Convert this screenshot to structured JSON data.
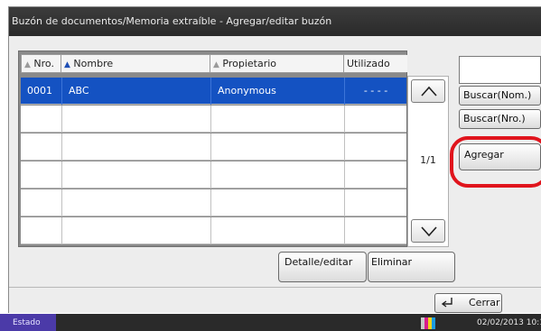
{
  "window": {
    "title": "Buzón de documentos/Memoria extraíble - Agregar/editar buzón"
  },
  "table": {
    "columns": [
      {
        "label": "Nro.",
        "sort_icon": "sort-triangle-grey"
      },
      {
        "label": "Nombre",
        "sort_icon": "sort-triangle-blue"
      },
      {
        "label": "Propietario",
        "sort_icon": "sort-triangle-grey"
      },
      {
        "label": "Utilizado"
      }
    ],
    "rows": [
      {
        "nro": "0001",
        "nombre": "ABC",
        "propietario": "Anonymous",
        "utilizado": "- - - -",
        "selected": true
      },
      {
        "nro": "",
        "nombre": "",
        "propietario": "",
        "utilizado": ""
      },
      {
        "nro": "",
        "nombre": "",
        "propietario": "",
        "utilizado": ""
      },
      {
        "nro": "",
        "nombre": "",
        "propietario": "",
        "utilizado": ""
      },
      {
        "nro": "",
        "nombre": "",
        "propietario": "",
        "utilizado": ""
      },
      {
        "nro": "",
        "nombre": "",
        "propietario": "",
        "utilizado": ""
      }
    ],
    "selected_color": "#1452c2"
  },
  "pager": {
    "indicator": "1/1",
    "up_icon": "chevron-up-icon",
    "down_icon": "chevron-down-icon"
  },
  "search": {
    "input_value": "",
    "by_name_label": "Buscar(Nom.)",
    "by_number_label": "Buscar(Nro.)"
  },
  "actions": {
    "add_label": "Agregar",
    "details_label": "Detalle/editar",
    "delete_label": "Eliminar",
    "close_label": "Cerrar",
    "highlight_color": "#e0141c"
  },
  "status_bar": {
    "status_label": "Estado",
    "datetime": "02/02/2013 10:1",
    "toner_icon": "toner-level-icon"
  }
}
